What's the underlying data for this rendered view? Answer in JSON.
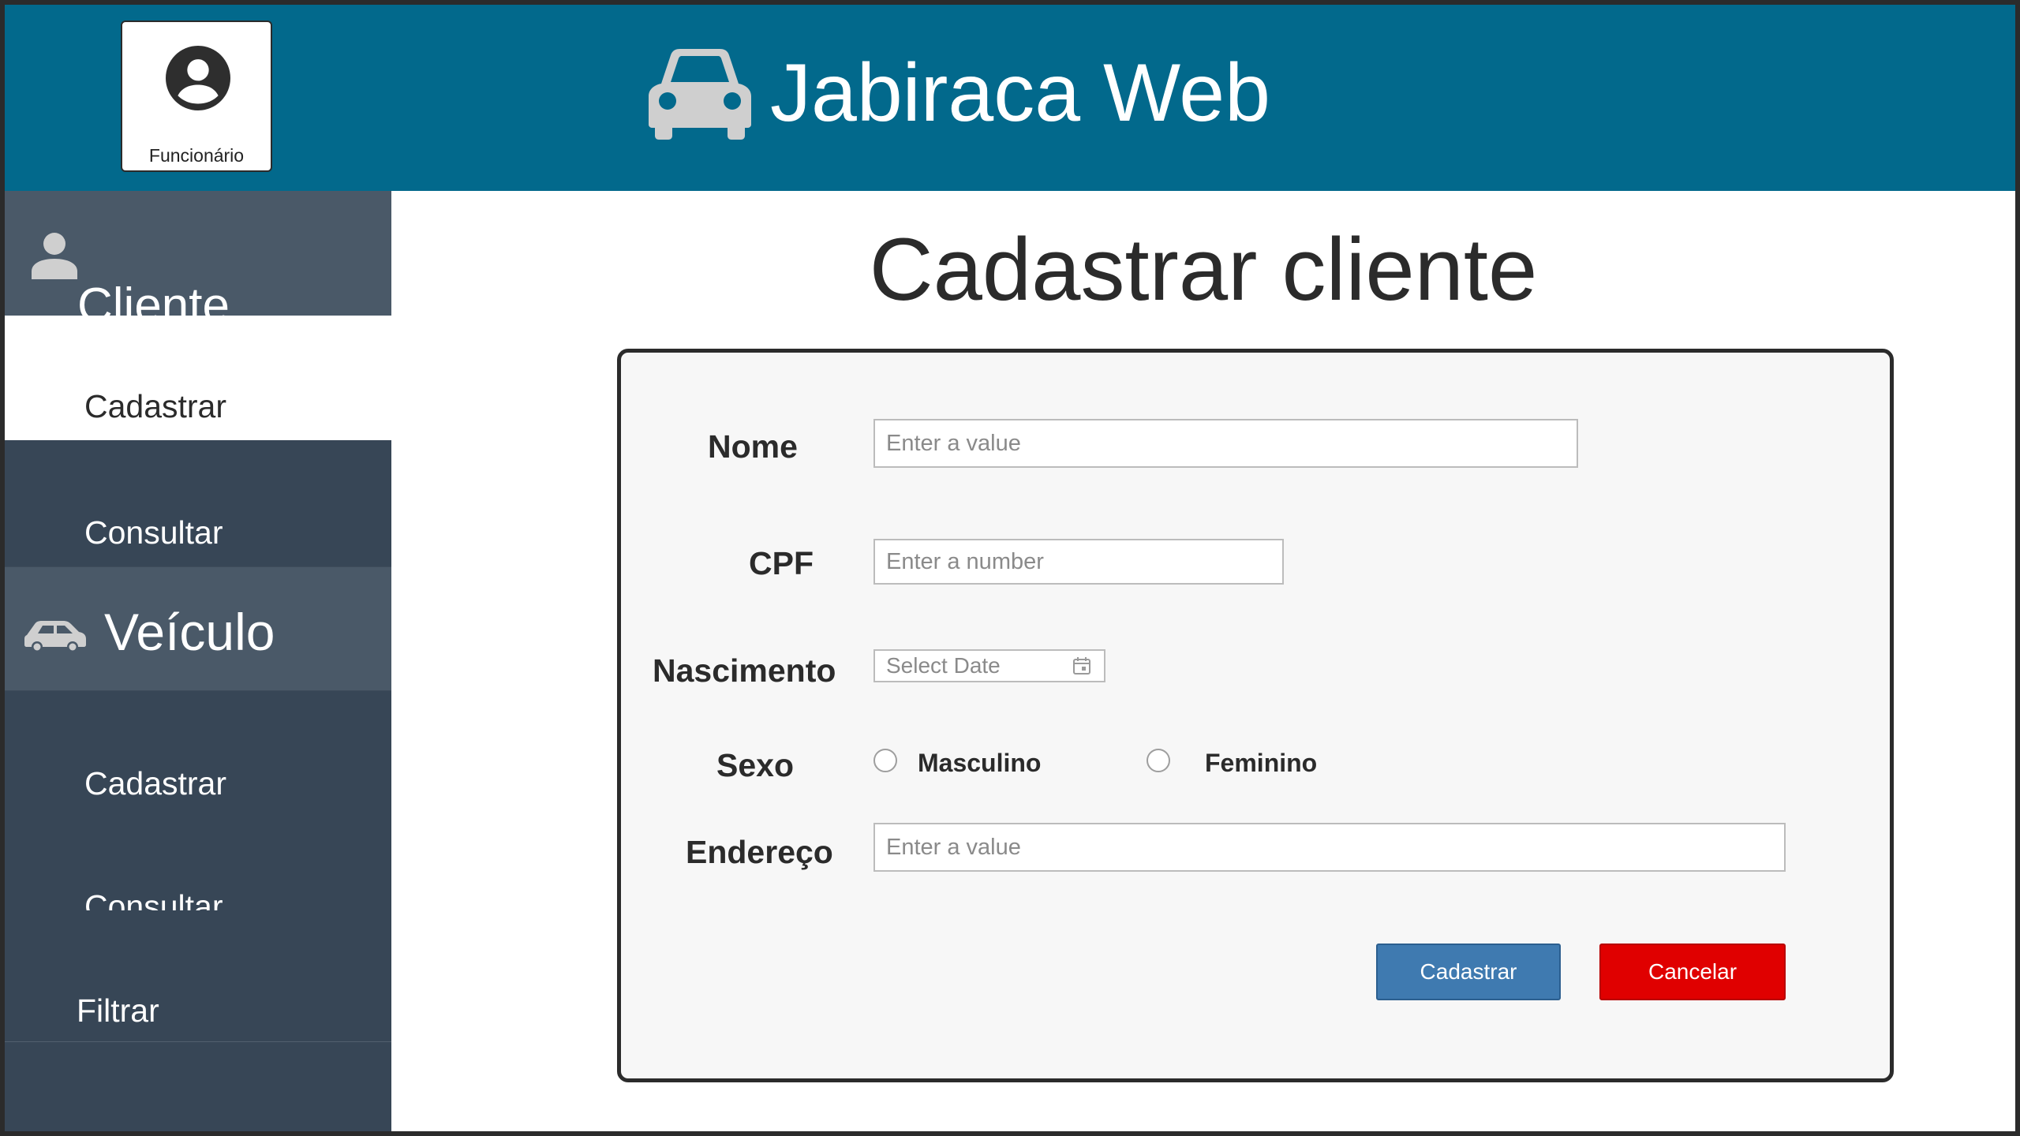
{
  "header": {
    "employee_label": "Funcionário",
    "brand_title": "Jabiraca Web",
    "brand_icon": "car-icon",
    "avatar_icon": "account-circle-icon"
  },
  "sidebar": {
    "cliente": {
      "title": "Cliente",
      "icon": "person-icon",
      "items": [
        {
          "label": "Cadastrar",
          "active": true
        },
        {
          "label": "Consultar",
          "active": false
        }
      ]
    },
    "veiculo": {
      "title": "Veículo",
      "icon": "car-icon",
      "items": [
        {
          "label": "Cadastrar",
          "active": false
        },
        {
          "label": "Consultar",
          "active": false
        }
      ]
    },
    "filtrar": {
      "label": "Filtrar"
    }
  },
  "page": {
    "title": "Cadastrar cliente"
  },
  "form": {
    "nome": {
      "label": "Nome",
      "placeholder": "Enter a value",
      "value": ""
    },
    "cpf": {
      "label": "CPF",
      "placeholder": "Enter a number",
      "value": ""
    },
    "nascimento": {
      "label": "Nascimento",
      "placeholder": "Select Date",
      "value": "",
      "icon": "calendar-icon"
    },
    "sexo": {
      "label": "Sexo",
      "options": [
        {
          "label": "Masculino",
          "checked": false
        },
        {
          "label": "Feminino",
          "checked": false
        }
      ]
    },
    "endereco": {
      "label": "Endereço",
      "placeholder": "Enter a value",
      "value": ""
    },
    "submit_label": "Cadastrar",
    "cancel_label": "Cancelar"
  },
  "colors": {
    "header_bg": "#02698c",
    "sidebar_bg": "#374656",
    "sidebar_section_bg": "#4a5968",
    "primary": "#3f7ab0",
    "danger": "#e00000"
  }
}
